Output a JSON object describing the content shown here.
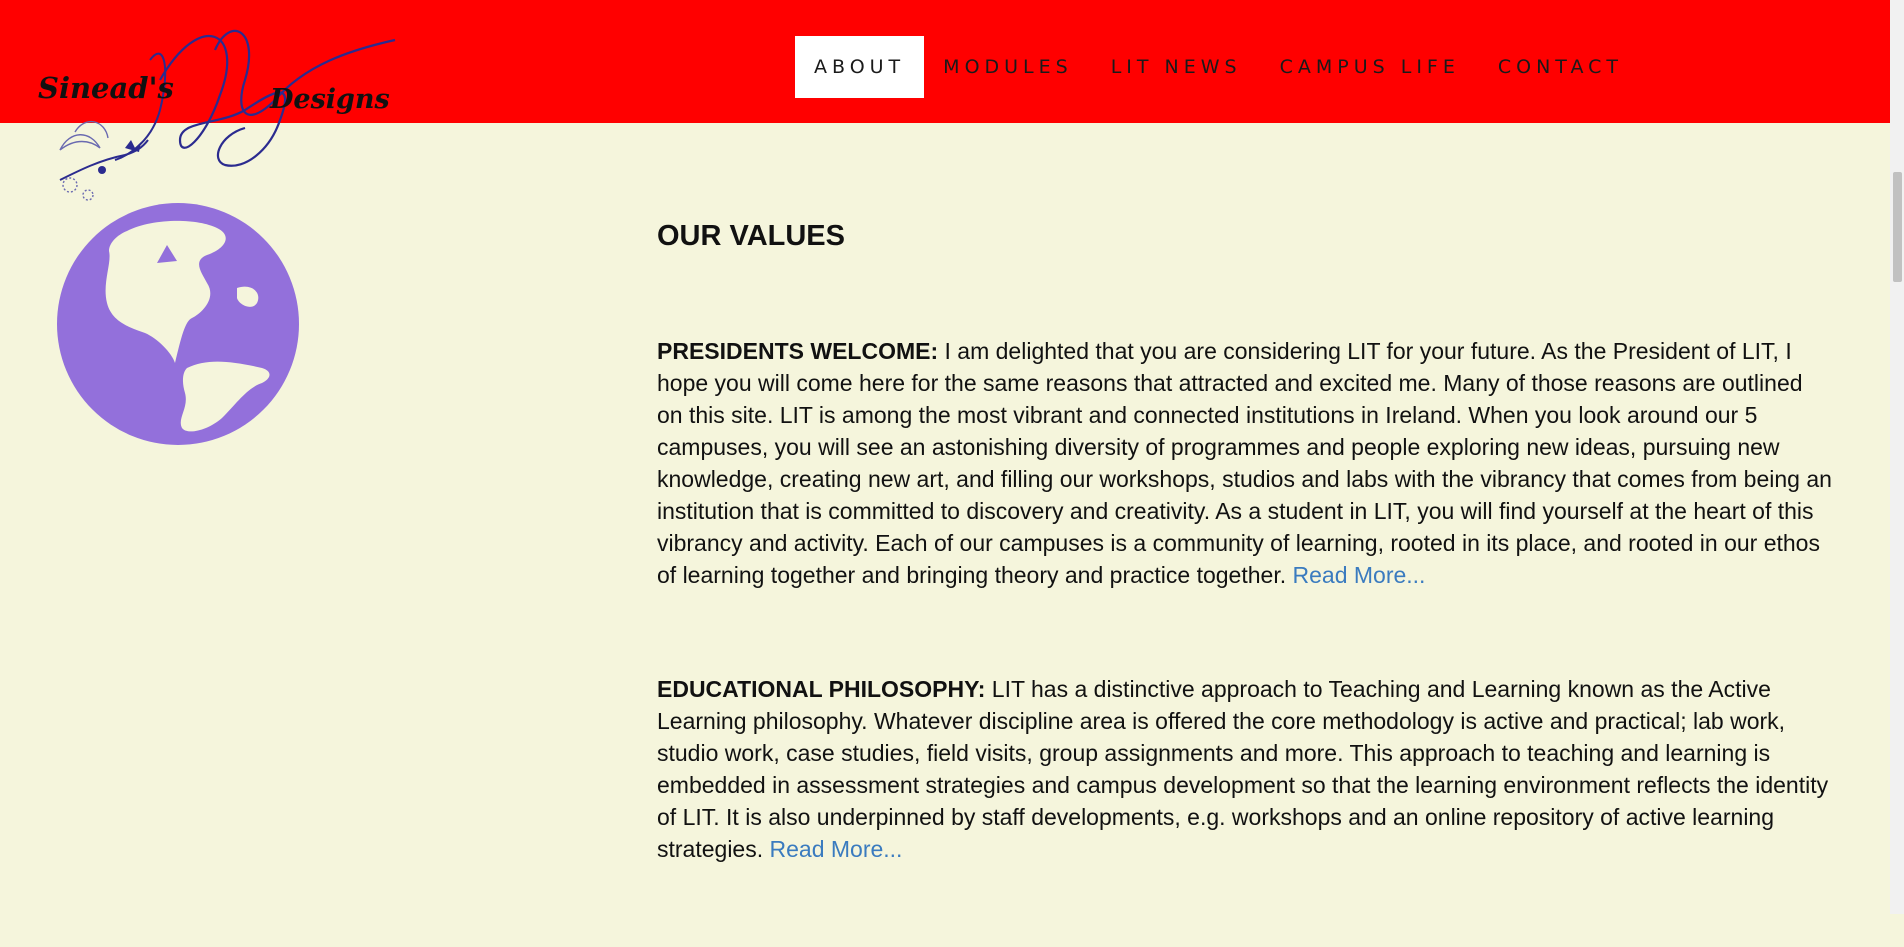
{
  "logo": {
    "word1": "Sinead's",
    "word2": "Designs"
  },
  "nav": {
    "items": [
      {
        "label": "ABOUT",
        "active": true
      },
      {
        "label": "MODULES",
        "active": false
      },
      {
        "label": "LIT NEWS",
        "active": false
      },
      {
        "label": "CAMPUS LIFE",
        "active": false
      },
      {
        "label": "CONTACT",
        "active": false
      }
    ]
  },
  "main": {
    "heading": "OUR VALUES",
    "sections": [
      {
        "title": "PRESIDENTS WELCOME:",
        "body": " I am delighted that you are considering LIT for your future. As the President of LIT, I hope you will come here for the same reasons that attracted and excited me. Many of those reasons are outlined on this site. LIT is among the most vibrant and connected institutions in Ireland. When you look around our 5 campuses, you will see an astonishing diversity of programmes and people exploring new ideas, pursuing new knowledge, creating new art, and filling our workshops, studios and labs with the vibrancy that comes from being an institution that is committed to discovery and creativity. As a student in LIT, you will find yourself at the heart of this vibrancy and activity. Each of our campuses is a community of learning, rooted in its place, and rooted in our ethos of learning together and bringing theory and practice together. ",
        "link": "Read More..."
      },
      {
        "title": "EDUCATIONAL PHILOSOPHY:",
        "body": " LIT has a distinctive approach to Teaching and Learning known as the Active Learning philosophy. Whatever discipline area is offered the core methodology is active and practical; lab work, studio work, case studies, field visits, group assignments and more. This approach to teaching and learning is embedded in assessment strategies and campus development so that the learning environment reflects the identity of LIT. It is also underpinned by staff developments, e.g. workshops and an online repository of active learning strategies. ",
        "link": "Read More..."
      }
    ]
  },
  "icons": {
    "logo": "sineads-designs-logo",
    "globe": "globe-icon"
  },
  "colors": {
    "header": "#ff0000",
    "background": "#f5f5dc",
    "globe": "#9370db",
    "link": "#3a7bbf",
    "logo_flourish": "#2b2b8f"
  }
}
